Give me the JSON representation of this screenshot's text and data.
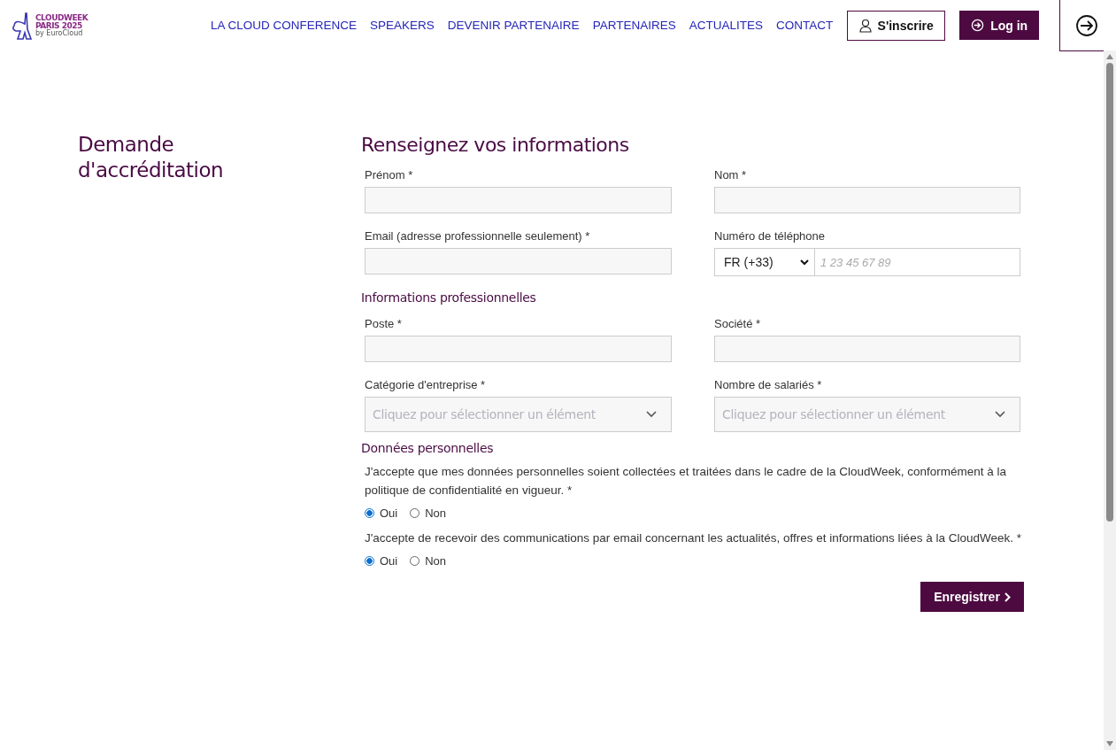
{
  "header": {
    "logo": {
      "line_1": "CLOUDWEEK",
      "line_2": "PARIS 2025",
      "line_3": "by EuroCloud"
    },
    "nav": [
      {
        "label": "LA CLOUD CONFERENCE"
      },
      {
        "label": "SPEAKERS"
      },
      {
        "label": "DEVENIR PARTENAIRE"
      },
      {
        "label": "PARTENAIRES"
      },
      {
        "label": "ACTUALITES"
      },
      {
        "label": "CONTACT"
      }
    ],
    "register_button": "S'inscrire",
    "login_button": "Log in"
  },
  "sidebar_title": "Demande d'accréditation",
  "form": {
    "title": "Renseignez vos informations",
    "sections": [
      {
        "fields": [
          {
            "kind": "text",
            "label": "Prénom *"
          },
          {
            "kind": "text",
            "label": "Nom *"
          },
          {
            "kind": "text",
            "label": "Email (adresse professionnelle seulement) *"
          },
          {
            "kind": "phone",
            "label": "Numéro de téléphone",
            "country": "FR (+33)",
            "placeholder": "1 23 45 67 89"
          }
        ]
      },
      {
        "heading": "Informations professionnelles",
        "fields": [
          {
            "kind": "text",
            "label": "Poste *"
          },
          {
            "kind": "text",
            "label": "Société *"
          },
          {
            "kind": "select",
            "label": "Catégorie d'entreprise *",
            "placeholder": "Cliquez pour sélectionner un élément"
          },
          {
            "kind": "select",
            "label": "Nombre de salariés *",
            "placeholder": "Cliquez pour sélectionner un élément"
          }
        ]
      }
    ],
    "consent_heading": "Données personnelles",
    "consents": [
      {
        "question": "J'accepte que mes données personnelles soient collectées et traitées dans le cadre de la CloudWeek, conformément à la politique de confidentialité en vigueur. *",
        "options": [
          {
            "label": "Oui",
            "selected": true
          },
          {
            "label": "Non",
            "selected": false
          }
        ]
      },
      {
        "question": "J'accepte de recevoir des communications par email concernant les actualités, offres et informations liées à la CloudWeek. *",
        "options": [
          {
            "label": "Oui",
            "selected": true
          },
          {
            "label": "Non",
            "selected": false
          }
        ]
      }
    ],
    "submit": "Enregistrer"
  }
}
